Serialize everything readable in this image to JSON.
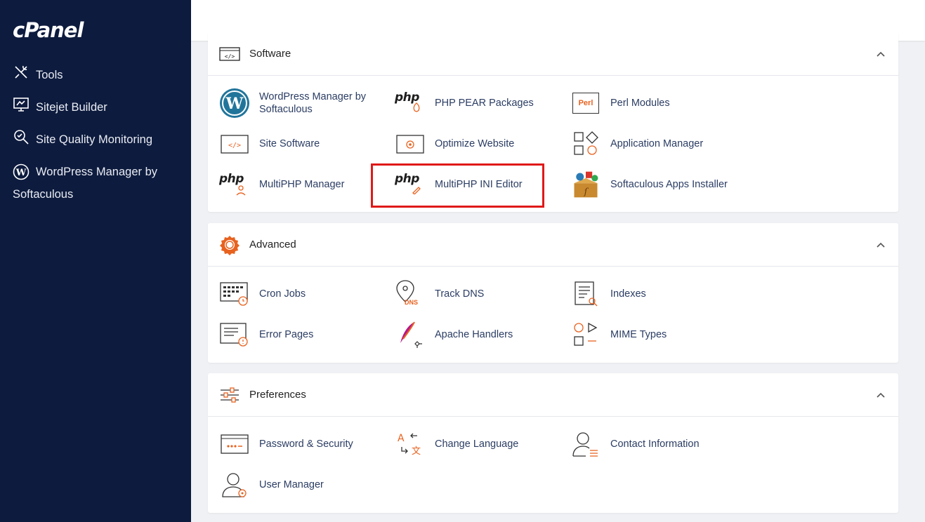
{
  "app": {
    "logo": "cPanel"
  },
  "sidebar": {
    "items": [
      {
        "label": "Tools",
        "icon": "tools-icon"
      },
      {
        "label": "Sitejet Builder",
        "icon": "sitejet-icon"
      },
      {
        "label": "Site Quality Monitoring",
        "icon": "magnifier-icon"
      },
      {
        "label": "WordPress Manager by Softaculous",
        "label_line1": "WordPress Manager by",
        "label_line2": "Softaculous",
        "icon": "wordpress-icon"
      }
    ]
  },
  "sections": {
    "software": {
      "title": "Software",
      "items": [
        {
          "label_line1": "WordPress Manager by",
          "label_line2": "Softaculous"
        },
        {
          "label": "PHP PEAR Packages"
        },
        {
          "label": "Perl Modules"
        },
        {
          "label": "Site Software"
        },
        {
          "label": "Optimize Website"
        },
        {
          "label": "Application Manager"
        },
        {
          "label": "MultiPHP Manager"
        },
        {
          "label": "MultiPHP INI Editor"
        },
        {
          "label": "Softaculous Apps Installer"
        }
      ]
    },
    "advanced": {
      "title": "Advanced",
      "items": [
        {
          "label": "Cron Jobs"
        },
        {
          "label": "Track DNS"
        },
        {
          "label": "Indexes"
        },
        {
          "label": "Error Pages"
        },
        {
          "label": "Apache Handlers"
        },
        {
          "label": "MIME Types"
        }
      ]
    },
    "preferences": {
      "title": "Preferences",
      "items": [
        {
          "label": "Password & Security"
        },
        {
          "label": "Change Language"
        },
        {
          "label": "Contact Information"
        },
        {
          "label": "User Manager"
        }
      ]
    }
  },
  "icon_text": {
    "php": "php",
    "perl": "Perl",
    "dns": "DNS"
  },
  "colors": {
    "sidebar": "#0d1b3e",
    "accent": "#e8621f",
    "link": "#2b3d63",
    "highlight": "#e01919"
  }
}
